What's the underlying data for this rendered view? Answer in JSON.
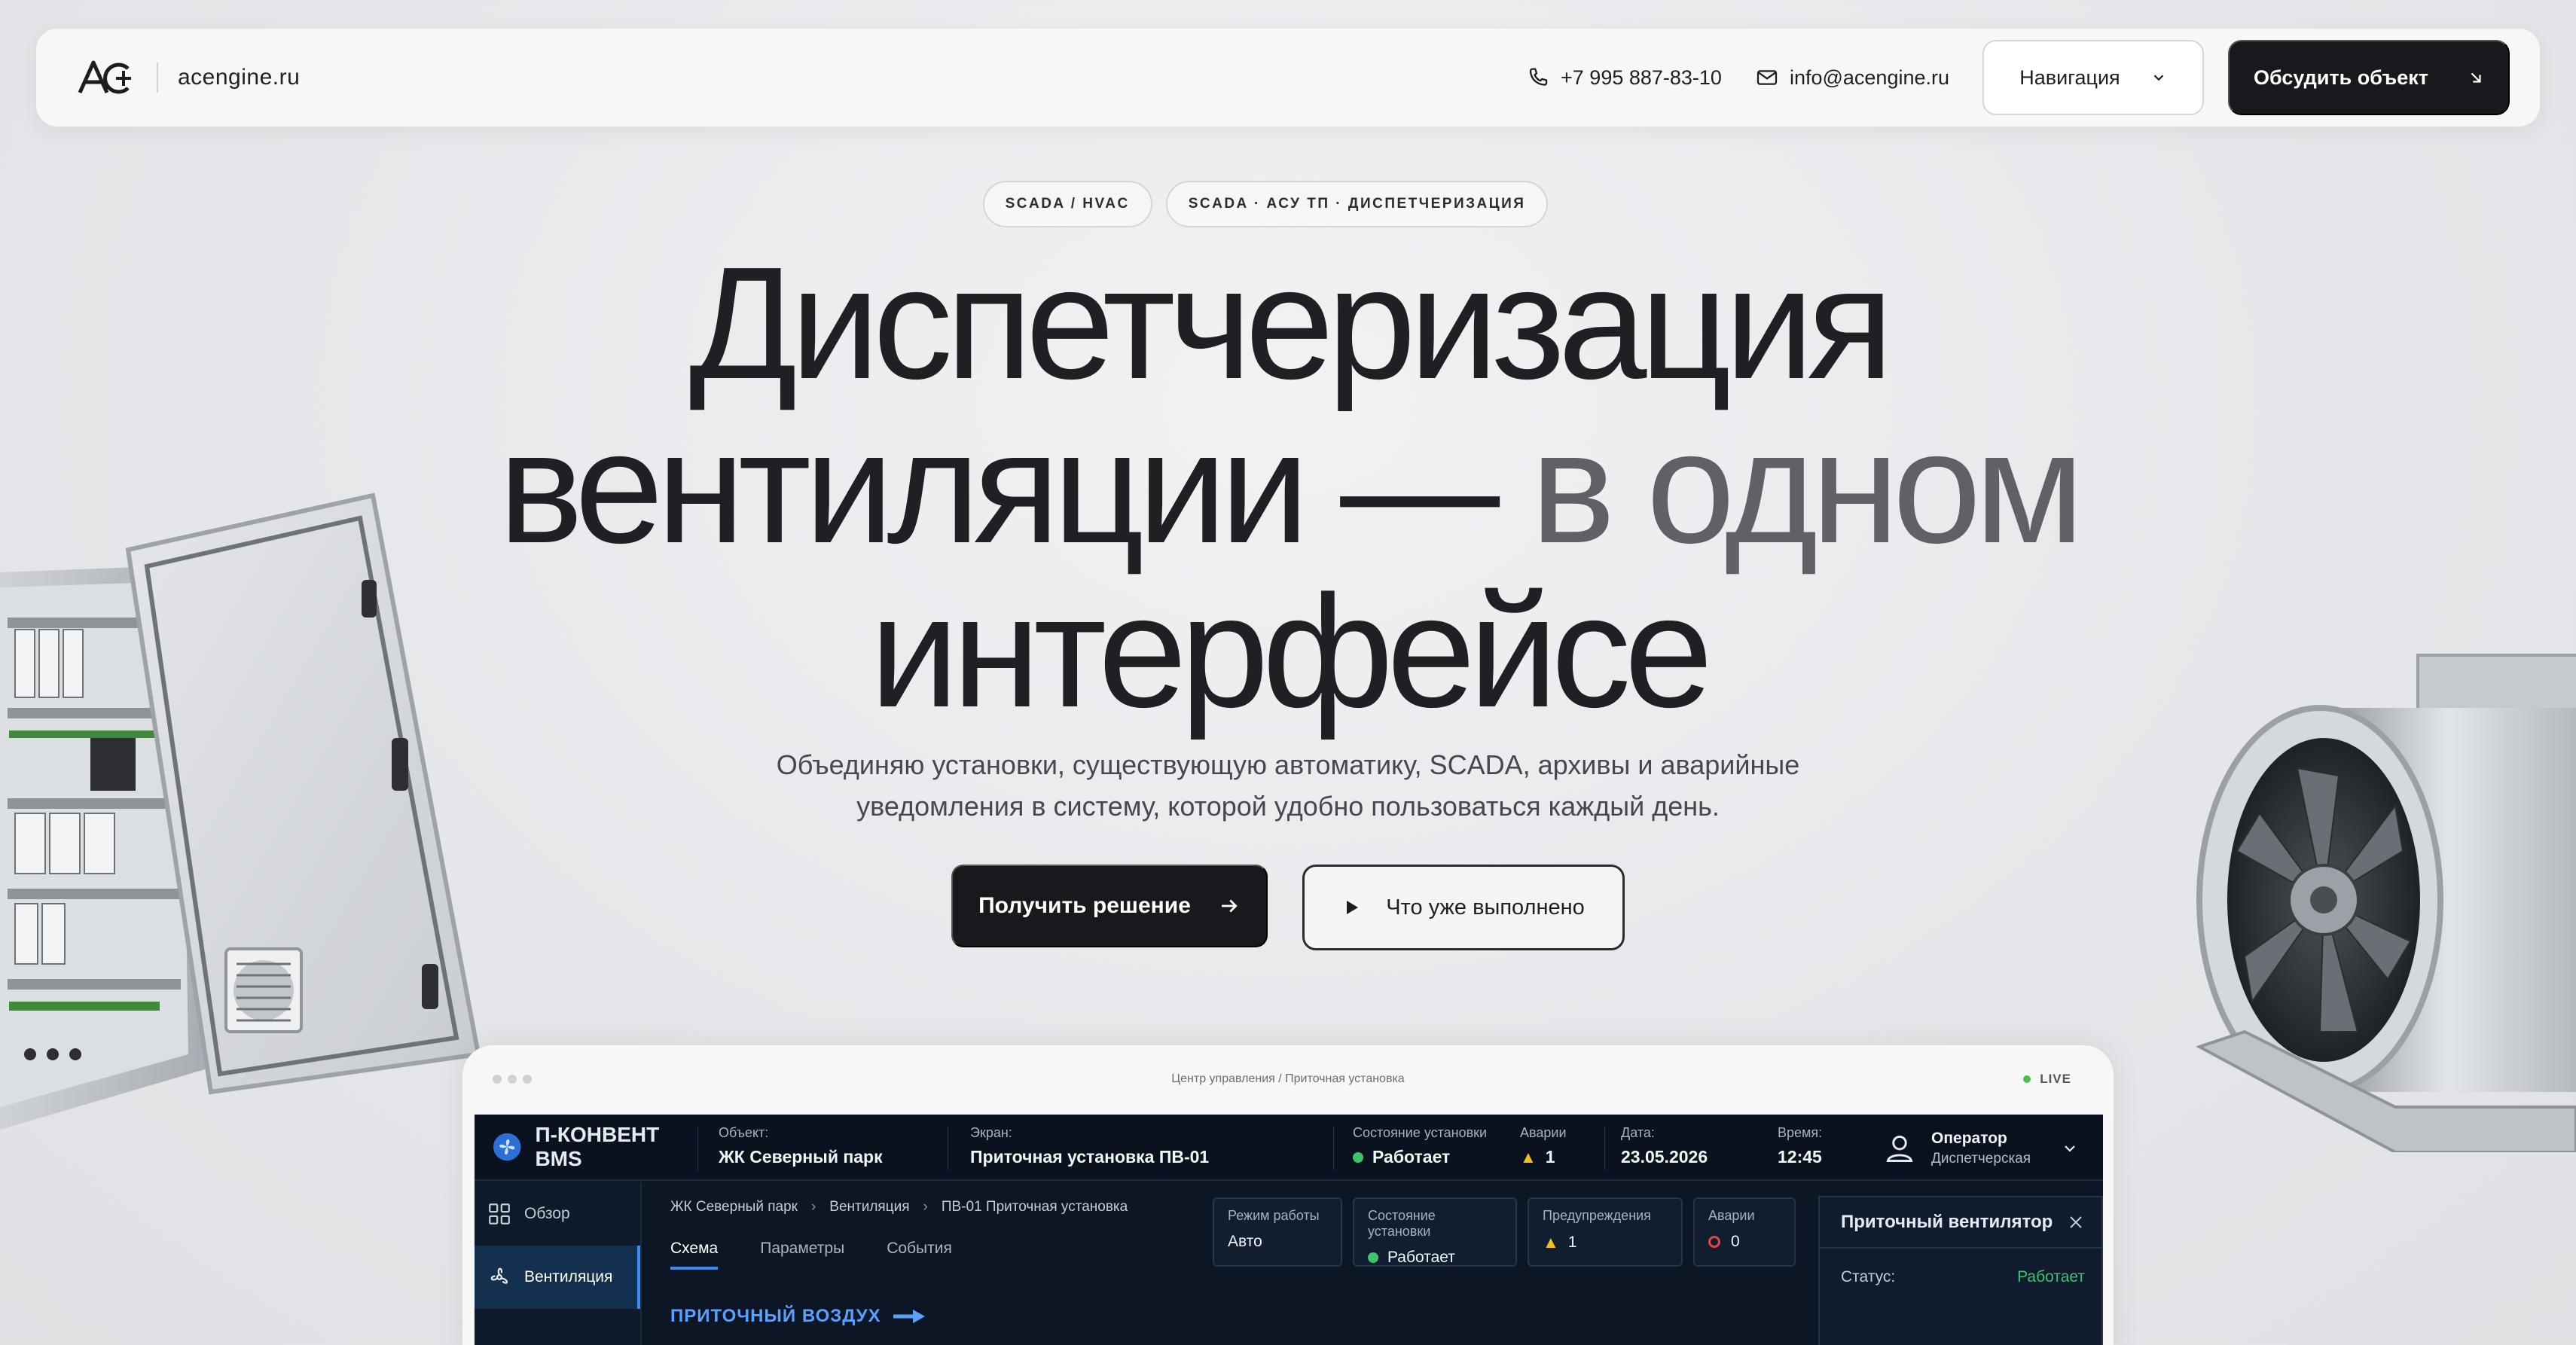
{
  "header": {
    "domain": "acengine.ru",
    "phone": "+7 995 887-83-10",
    "email": "info@acengine.ru",
    "nav_label": "Навигация",
    "cta_label": "Обсудить объект"
  },
  "hero": {
    "tags": [
      "SCADA / HVAC",
      "SCADA · АСУ ТП · ДИСПЕТЧЕРИЗАЦИЯ"
    ],
    "title_line1": "Диспетчеризация",
    "title_line2_main": "вентиляции — ",
    "title_line2_muted": "в одном",
    "title_line3": "интерфейсе",
    "lead_line1": "Объединяю установки, существующую автоматику, SCADA, архивы и аварийные",
    "lead_line2": "уведомления в систему, которой удобно пользоваться каждый день.",
    "primary_button": "Получить решение",
    "secondary_button": "Что уже выполнено"
  },
  "preview": {
    "window_title": "Центр управления / Приточная установка",
    "live": "LIVE",
    "brand": "П-КОНВЕНТ BMS",
    "object_label": "Объект:",
    "object_value": "ЖК Северный парк",
    "screen_label": "Экран:",
    "screen_value": "Приточная установка ПВ-01",
    "state_label": "Состояние установки",
    "state_value": "Работает",
    "alarms_label": "Аварии",
    "alarms_value": "1",
    "date_label": "Дата:",
    "date_value": "23.05.2026",
    "time_label": "Время:",
    "time_value": "12:45",
    "operator_name": "Оператор",
    "operator_role": "Диспетчерская",
    "sidebar": [
      "Обзор",
      "Вентиляция"
    ],
    "breadcrumb": [
      "ЖК Северный парк",
      "Вентиляция",
      "ПВ-01 Приточная установка"
    ],
    "tabs": [
      "Схема",
      "Параметры",
      "События"
    ],
    "section_title": "ПРИТОЧНЫЙ ВОЗДУХ",
    "cards": [
      {
        "label": "Режим работы",
        "value": "Авто"
      },
      {
        "label": "Состояние установки",
        "value": "Работает"
      },
      {
        "label": "Предупреждения",
        "value": "1"
      },
      {
        "label": "Аварии",
        "value": "0"
      }
    ],
    "panel_title": "Приточный вентилятор",
    "panel_status_label": "Статус:",
    "panel_status_value": "Работает"
  },
  "colors": {
    "accent_dark": "#18191c",
    "scada_bg": "#0c1624",
    "scada_accent": "#3b8cf0",
    "ok_green": "#3cc46a",
    "warn_yellow": "#f2c01c",
    "alarm_red": "#e64646"
  },
  "icons": [
    "logo-icon",
    "phone-icon",
    "mail-icon",
    "chevron-down-icon",
    "arrow-down-right-icon",
    "arrow-right-icon",
    "play-icon",
    "grid-icon",
    "fan-icon",
    "user-icon",
    "close-icon",
    "warning-icon"
  ]
}
